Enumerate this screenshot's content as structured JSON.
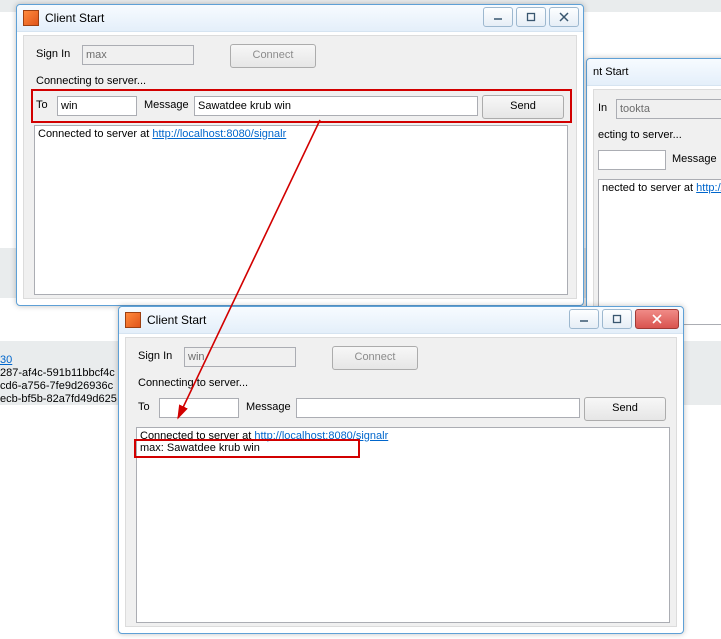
{
  "window_top": {
    "title": "Client Start",
    "signin_label": "Sign In",
    "signin_value": "max",
    "connect_label": "Connect",
    "status": "Connecting to server...",
    "to_label": "To",
    "to_value": "win",
    "msg_label": "Message",
    "msg_value": "Sawatdee krub win",
    "send_label": "Send",
    "log_prefix": "Connected to server at ",
    "log_link": "http://localhost:8080/signalr"
  },
  "window_right": {
    "title_fragment": "nt Start",
    "signin_label_fragment": "In",
    "signin_value": "tookta",
    "status_fragment": "ecting to server...",
    "msg_label": "Message",
    "log_fragment": "nected to server at ",
    "log_link_fragment": "http://lo"
  },
  "window_bottom": {
    "title": "Client Start",
    "signin_label": "Sign In",
    "signin_value": "win",
    "connect_label": "Connect",
    "status": "Connecting to server...",
    "to_label": "To",
    "to_value": "",
    "msg_label": "Message",
    "msg_value": "",
    "send_label": "Send",
    "log_prefix": "Connected to server at ",
    "log_link": "http://localhost:8080/signalr",
    "log_line2": "max: Sawatdee krub win"
  },
  "background_ids": {
    "line1": "30",
    "line2": "287-af4c-591b11bbcf4c",
    "line3": "cd6-a756-7fe9d26936c",
    "line4": "ecb-bf5b-82a7fd49d625"
  }
}
